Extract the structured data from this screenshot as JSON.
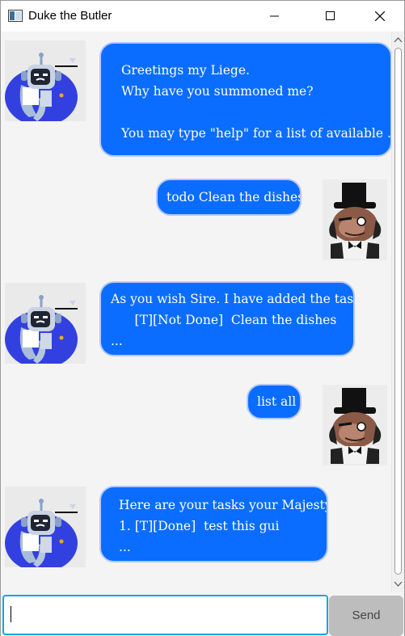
{
  "window": {
    "title": "Duke the Butler",
    "app_icon": "app-window-icon",
    "controls": [
      "minimize-icon",
      "maximize-icon",
      "close-icon"
    ]
  },
  "messages": [
    {
      "sender": "duke",
      "avatar_icon": "duke-robot-avatar",
      "text": "Greetings my Liege.\nWhy have you summoned me?\n\nYou may type \"help\" for a list of available ..."
    },
    {
      "sender": "user",
      "avatar_icon": "user-top-hat-avatar",
      "text": "todo Clean the dishes"
    },
    {
      "sender": "duke",
      "avatar_icon": "duke-robot-avatar",
      "text": "As you wish Sire. I have added the task:\n      [T][Not Done]  Clean the dishes\n..."
    },
    {
      "sender": "user",
      "avatar_icon": "user-top-hat-avatar",
      "text": "list all"
    },
    {
      "sender": "duke",
      "avatar_icon": "duke-robot-avatar",
      "text": "Here are your tasks your Majesty:\n1. [T][Done]  test this gui\n..."
    }
  ],
  "input": {
    "value": "",
    "placeholder": ""
  },
  "send_button": {
    "label": "Send"
  },
  "colors": {
    "bubble": "#0a6dff",
    "bubble_border": "#b3c7ff",
    "chat_background": "#f4f4f4",
    "input_focus": "#1aa3e0",
    "send_button": "#bdbdbd"
  }
}
